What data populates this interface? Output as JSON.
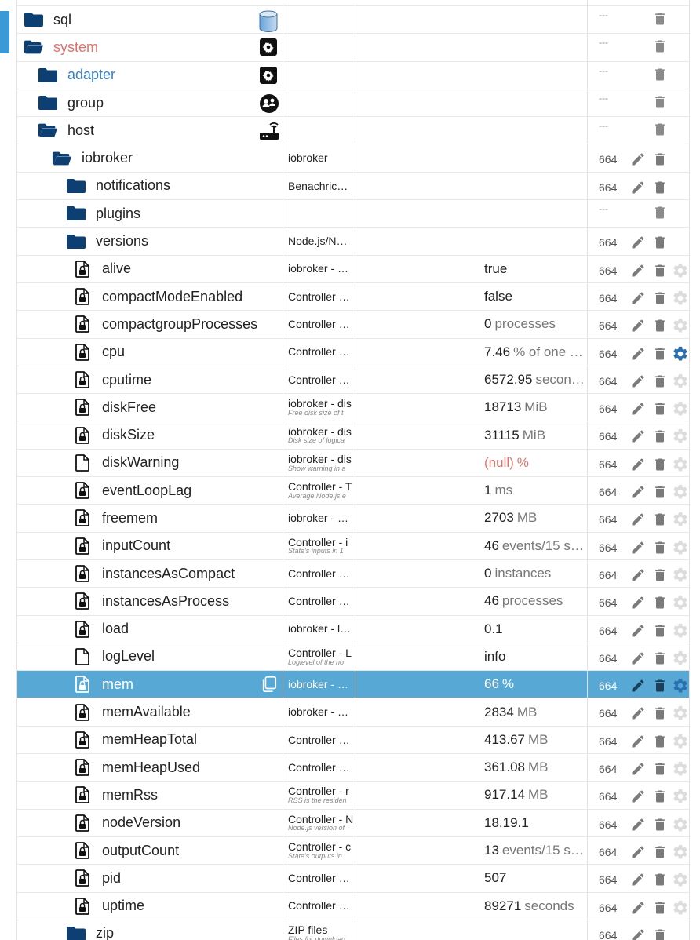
{
  "rows": [
    {
      "name": "sql",
      "indent": 0,
      "icon": "folder",
      "type_icon": "database-icon",
      "desc": "",
      "acl": "---",
      "edit": false,
      "gear": false
    },
    {
      "name": "system",
      "indent": 0,
      "icon": "folder-open",
      "type_icon": "gear-icon",
      "name_color": "red",
      "desc": "",
      "acl": "---",
      "edit": false,
      "gear": false
    },
    {
      "name": "adapter",
      "indent": 1,
      "icon": "folder",
      "type_icon": "gear-icon",
      "name_color": "blue",
      "desc": "",
      "acl": "---",
      "edit": false,
      "gear": false
    },
    {
      "name": "group",
      "indent": 1,
      "icon": "folder",
      "type_icon": "group-icon",
      "desc": "",
      "acl": "---",
      "edit": false,
      "gear": false
    },
    {
      "name": "host",
      "indent": 1,
      "icon": "folder-open",
      "type_icon": "router-icon",
      "desc": "",
      "acl": "---",
      "edit": false,
      "gear": false
    },
    {
      "name": "iobroker",
      "indent": 2,
      "icon": "folder-open",
      "desc": "iobroker",
      "acl": "664",
      "edit": true,
      "gear": false
    },
    {
      "name": "notifications",
      "indent": 3,
      "icon": "folder",
      "desc": "Benachric…",
      "acl": "664",
      "edit": true,
      "gear": false
    },
    {
      "name": "plugins",
      "indent": 3,
      "icon": "folder",
      "desc": "",
      "acl": "---",
      "edit": false,
      "gear": false
    },
    {
      "name": "versions",
      "indent": 3,
      "icon": "folder",
      "desc": "Node.js/N…",
      "acl": "664",
      "edit": true,
      "gear": false
    },
    {
      "name": "alive",
      "indent": 4,
      "icon": "file-lock",
      "desc": "iobroker - …",
      "val": "true",
      "unit": "",
      "acl": "664",
      "edit": true,
      "gear": true
    },
    {
      "name": "compactModeEnabled",
      "indent": 4,
      "icon": "file-lock",
      "desc": "Controller …",
      "val": "false",
      "unit": "",
      "acl": "664",
      "edit": true,
      "gear": true
    },
    {
      "name": "compactgroupProcesses",
      "indent": 4,
      "icon": "file-lock",
      "desc": "Controller …",
      "val": "0",
      "unit": "processes",
      "acl": "664",
      "edit": true,
      "gear": true
    },
    {
      "name": "cpu",
      "indent": 4,
      "icon": "file-lock",
      "desc": "Controller …",
      "val": "7.46",
      "unit": "% of one …",
      "acl": "664",
      "edit": true,
      "gear": true,
      "gear_active": true
    },
    {
      "name": "cputime",
      "indent": 4,
      "icon": "file-lock",
      "desc": "Controller …",
      "val": "6572.95",
      "unit": "secon…",
      "acl": "664",
      "edit": true,
      "gear": true
    },
    {
      "name": "diskFree",
      "indent": 4,
      "icon": "file-lock",
      "desc": "iobroker - dis",
      "desc_sub": "Free disk size of t",
      "val": "18713",
      "unit": "MiB",
      "acl": "664",
      "edit": true,
      "gear": true
    },
    {
      "name": "diskSize",
      "indent": 4,
      "icon": "file-lock",
      "desc": "iobroker - dis",
      "desc_sub": "Disk size of logica",
      "val": "31115",
      "unit": "MiB",
      "acl": "664",
      "edit": true,
      "gear": true
    },
    {
      "name": "diskWarning",
      "indent": 4,
      "icon": "file",
      "desc": "iobroker - dis",
      "desc_sub": "Show warning in a",
      "val": "(null)",
      "unit": "%",
      "val_null": true,
      "acl": "664",
      "edit": true,
      "gear": true
    },
    {
      "name": "eventLoopLag",
      "indent": 4,
      "icon": "file-lock",
      "desc": "Controller - T",
      "desc_sub": "Average Node.js e",
      "val": "1",
      "unit": "ms",
      "acl": "664",
      "edit": true,
      "gear": true
    },
    {
      "name": "freemem",
      "indent": 4,
      "icon": "file-lock",
      "desc": "iobroker - …",
      "val": "2703",
      "unit": "MB",
      "acl": "664",
      "edit": true,
      "gear": true
    },
    {
      "name": "inputCount",
      "indent": 4,
      "icon": "file-lock",
      "desc": "Controller - i",
      "desc_sub": "State's inputs in 1",
      "val": "46",
      "unit": "events/15 s…",
      "acl": "664",
      "edit": true,
      "gear": true
    },
    {
      "name": "instancesAsCompact",
      "indent": 4,
      "icon": "file-lock",
      "desc": "Controller …",
      "val": "0",
      "unit": "instances",
      "acl": "664",
      "edit": true,
      "gear": true
    },
    {
      "name": "instancesAsProcess",
      "indent": 4,
      "icon": "file-lock",
      "desc": "Controller …",
      "val": "46",
      "unit": "processes",
      "acl": "664",
      "edit": true,
      "gear": true
    },
    {
      "name": "load",
      "indent": 4,
      "icon": "file-lock",
      "desc": "iobroker - l…",
      "val": "0.1",
      "unit": "",
      "acl": "664",
      "edit": true,
      "gear": true
    },
    {
      "name": "logLevel",
      "indent": 4,
      "icon": "file",
      "desc": "Controller - L",
      "desc_sub": "Loglevel of the ho",
      "val": "info",
      "unit": "",
      "acl": "664",
      "edit": true,
      "gear": true
    },
    {
      "name": "mem",
      "indent": 4,
      "icon": "file-lock",
      "desc": "iobroker - …",
      "val": "66",
      "unit": "%",
      "acl": "664",
      "edit": true,
      "gear": true,
      "gear_active": true,
      "selected": true
    },
    {
      "name": "memAvailable",
      "indent": 4,
      "icon": "file-lock",
      "desc": "iobroker - …",
      "val": "2834",
      "unit": "MB",
      "acl": "664",
      "edit": true,
      "gear": true
    },
    {
      "name": "memHeapTotal",
      "indent": 4,
      "icon": "file-lock",
      "desc": "Controller …",
      "val": "413.67",
      "unit": "MB",
      "acl": "664",
      "edit": true,
      "gear": true
    },
    {
      "name": "memHeapUsed",
      "indent": 4,
      "icon": "file-lock",
      "desc": "Controller …",
      "val": "361.08",
      "unit": "MB",
      "acl": "664",
      "edit": true,
      "gear": true
    },
    {
      "name": "memRss",
      "indent": 4,
      "icon": "file-lock",
      "desc": "Controller - r",
      "desc_sub": "RSS is the residen",
      "val": "917.14",
      "unit": "MB",
      "acl": "664",
      "edit": true,
      "gear": true
    },
    {
      "name": "nodeVersion",
      "indent": 4,
      "icon": "file-lock",
      "desc": "Controller - N",
      "desc_sub": "Node.js version of",
      "val": "18.19.1",
      "unit": "",
      "acl": "664",
      "edit": true,
      "gear": true
    },
    {
      "name": "outputCount",
      "indent": 4,
      "icon": "file-lock",
      "desc": "Controller - c",
      "desc_sub": "State's outputs in",
      "val": "13",
      "unit": "events/15 s…",
      "acl": "664",
      "edit": true,
      "gear": true
    },
    {
      "name": "pid",
      "indent": 4,
      "icon": "file-lock",
      "desc": "Controller …",
      "val": "507",
      "unit": "",
      "acl": "664",
      "edit": true,
      "gear": true
    },
    {
      "name": "uptime",
      "indent": 4,
      "icon": "file-lock",
      "desc": "Controller …",
      "val": "89271",
      "unit": "seconds",
      "acl": "664",
      "edit": true,
      "gear": true
    },
    {
      "name": "zip",
      "indent": 3,
      "icon": "folder",
      "desc": "ZIP files",
      "desc_sub": "Files for download",
      "acl": "664",
      "edit": true,
      "gear": false
    }
  ],
  "colors": {
    "folder": "#0e3f73",
    "selected_bg": "#58a8d6",
    "accent_red": "#e2716c",
    "accent_blue": "#3b7fc4",
    "gear_active": "#2a6fb0"
  }
}
